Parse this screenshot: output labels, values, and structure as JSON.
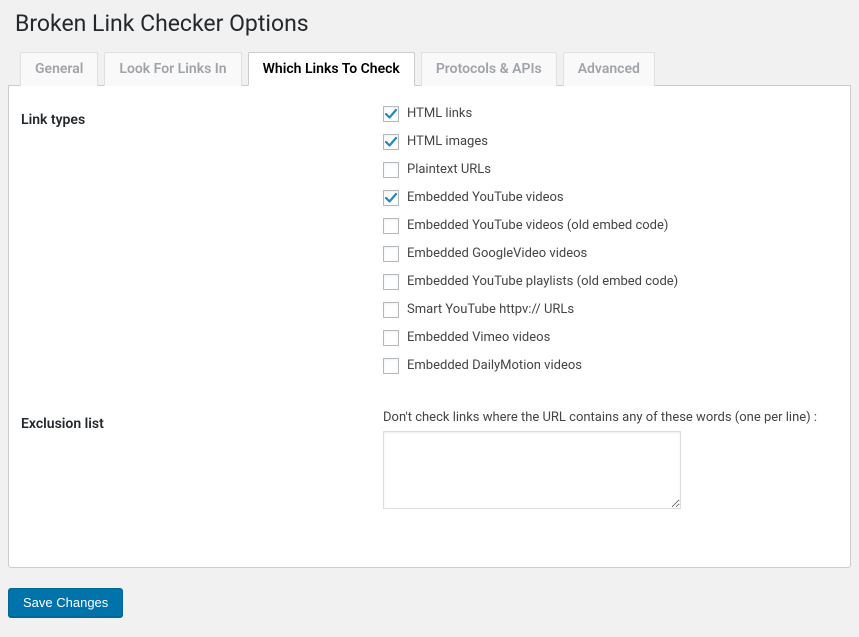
{
  "page_title": "Broken Link Checker Options",
  "tabs": [
    {
      "label": "General",
      "active": false
    },
    {
      "label": "Look For Links In",
      "active": false
    },
    {
      "label": "Which Links To Check",
      "active": true
    },
    {
      "label": "Protocols & APIs",
      "active": false
    },
    {
      "label": "Advanced",
      "active": false
    }
  ],
  "link_types_label": "Link types",
  "link_types": [
    {
      "label": "HTML links",
      "checked": true
    },
    {
      "label": "HTML images",
      "checked": true
    },
    {
      "label": "Plaintext URLs",
      "checked": false
    },
    {
      "label": "Embedded YouTube videos",
      "checked": true
    },
    {
      "label": "Embedded YouTube videos (old embed code)",
      "checked": false
    },
    {
      "label": "Embedded GoogleVideo videos",
      "checked": false
    },
    {
      "label": "Embedded YouTube playlists (old embed code)",
      "checked": false
    },
    {
      "label": "Smart YouTube httpv:// URLs",
      "checked": false
    },
    {
      "label": "Embedded Vimeo videos",
      "checked": false
    },
    {
      "label": "Embedded DailyMotion videos",
      "checked": false
    }
  ],
  "exclusion_label": "Exclusion list",
  "exclusion_help": "Don't check links where the URL contains any of these words (one per line) :",
  "exclusion_value": "",
  "save_button": "Save Changes"
}
